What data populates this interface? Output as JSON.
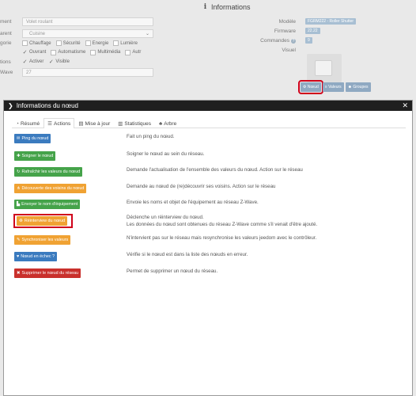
{
  "background": {
    "title": "Informations",
    "form": {
      "name_label": "ment",
      "name_placeholder": "Volet roulant",
      "parent_label": "arent",
      "parent_value": "Cuisine",
      "category_label": "gorie",
      "categories_row1": [
        "Chauffage",
        "Sécurité",
        "Energie",
        "Lumière"
      ],
      "categories_row2": [
        "Ouvrant",
        "Automatisme",
        "Multimédia",
        "Autr"
      ],
      "options_label": "tions",
      "options": [
        "Activer",
        "Visible"
      ],
      "wave_label": "Wave",
      "wave_value": "27"
    },
    "props": {
      "model_label": "Modèle",
      "model_value": "FGRM222 - Roller Shutter",
      "firmware_label": "Firmware",
      "firmware_value": "22.22",
      "commands_label": "Commandes",
      "commands_value": "9",
      "visual_label": "Visuel"
    },
    "buttons": [
      {
        "label": "Nœud",
        "icon": "gear-icon"
      },
      {
        "label": "Valeurs",
        "icon": "list-icon"
      },
      {
        "label": "Groupes",
        "icon": "users-icon"
      }
    ]
  },
  "modal": {
    "title": "Informations du nœud",
    "tabs": [
      {
        "label": "Résumé",
        "icon": "dashboard-icon"
      },
      {
        "label": "Actions",
        "icon": "list-icon"
      },
      {
        "label": "Mise à jour",
        "icon": "server-icon"
      },
      {
        "label": "Statistiques",
        "icon": "chart-icon"
      },
      {
        "label": "Arbre",
        "icon": "tree-icon"
      }
    ],
    "actions": [
      {
        "label": "Ping du nœud",
        "desc": "Fait un ping du nœud.",
        "color": "#3b7bbf"
      },
      {
        "label": "Soigner le nœud",
        "desc": "Soigner le nœud au sein du réseau.",
        "color": "#45a34a"
      },
      {
        "label": "Rafraîchir les valeurs du nœud",
        "desc": "Demande l'actualisation de l'ensemble des valeurs du nœud. Action sur le réseau",
        "color": "#45a34a"
      },
      {
        "label": "Découverte des voisins du nœud",
        "desc": "Demande au nœud de (re)découvrir ses voisins. Action sur le réseau",
        "color": "#f0a233"
      },
      {
        "label": "Envoyer le nom d'équipement",
        "desc": "Envoie les noms et objet de l'équipement au réseau Z-Wave.",
        "color": "#45a34a"
      },
      {
        "label": "Réinterview du nœud",
        "desc": "Déclenche un réinterview du nœud.",
        "desc2": "Les données du nœud sont obtenues du réseau Z-Wave comme s'il venait d'être ajouté.",
        "color": "#f0a233"
      },
      {
        "label": "Synchroniser les valeurs",
        "desc": "N'intervient pas sur le réseau mais resynchronise les valeurs jeedom avec le contrôleur.",
        "color": "#f0a233"
      },
      {
        "label": "Nœud en échec ?",
        "desc": "Vérifie si le nœud est dans la liste des nœuds en erreur.",
        "color": "#3b7bbf"
      },
      {
        "label": "Supprimer le nœud du réseau",
        "desc": "Permet de supprimer un nœud du réseau.",
        "color": "#c9302c"
      }
    ]
  }
}
